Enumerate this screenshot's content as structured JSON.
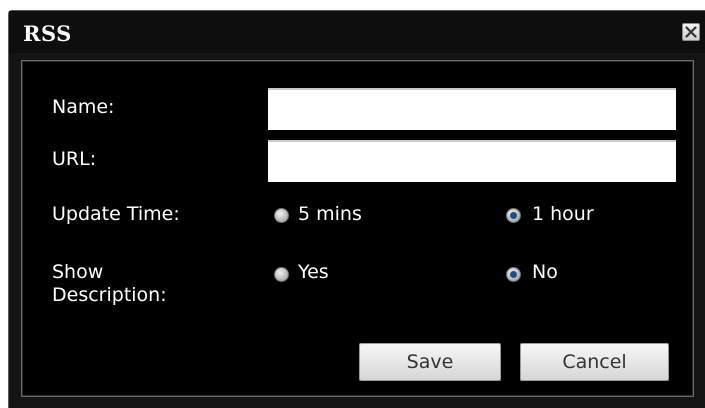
{
  "dialog": {
    "title": "RSS",
    "close_icon": "close-x-icon"
  },
  "form": {
    "name_label": "Name:",
    "name_value": "",
    "url_label": "URL:",
    "url_value": "",
    "update_time": {
      "label": "Update Time:",
      "options": [
        "5 mins",
        "1 hour"
      ],
      "selected": "1 hour"
    },
    "show_description": {
      "label_line1": "Show",
      "label_line2": "Description:",
      "options": [
        "Yes",
        "No"
      ],
      "selected": "No"
    }
  },
  "buttons": {
    "save_label": "Save",
    "cancel_label": "Cancel"
  },
  "colors": {
    "background": "#000000",
    "title_bar": "#0e0e0e",
    "radio_selected": "#1e4d8c",
    "text": "#ffffff"
  }
}
